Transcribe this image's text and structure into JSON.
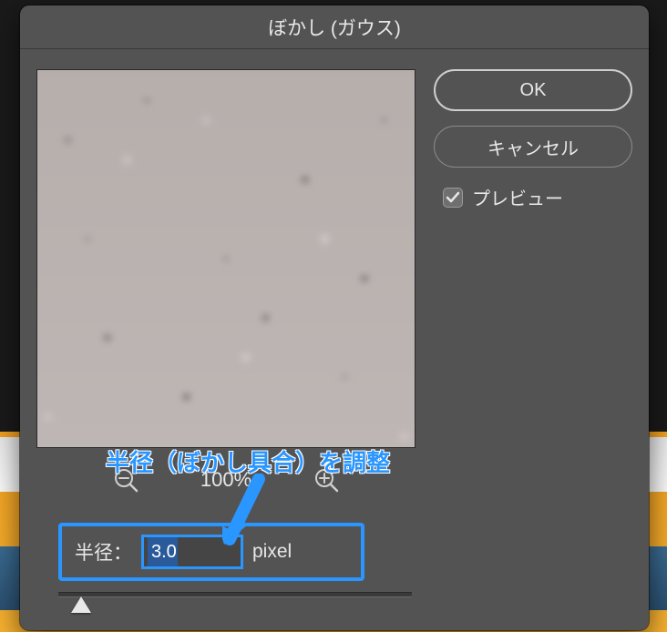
{
  "dialog": {
    "title": "ぼかし (ガウス)",
    "ok_label": "OK",
    "cancel_label": "キャンセル",
    "preview_label": "プレビュー",
    "preview_checked": true
  },
  "zoom": {
    "percent_label": "100%"
  },
  "radius": {
    "label": "半径：",
    "value": "3.0",
    "unit": "pixel"
  },
  "annotation": {
    "text": "半径（ぼかし具合）を調整"
  }
}
